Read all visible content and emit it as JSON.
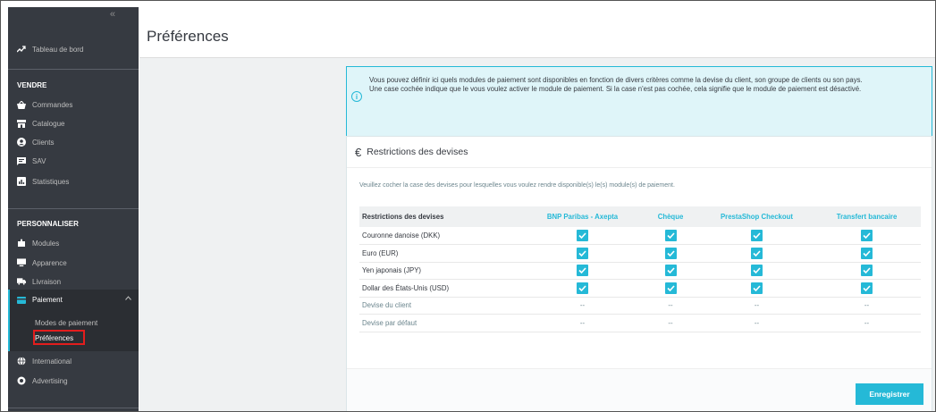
{
  "sidebar": {
    "collapse_glyph": "«",
    "dashboard": "Tableau de bord",
    "sections": {
      "sell": "VENDRE",
      "customize": "PERSONNALISER"
    },
    "sell_items": [
      "Commandes",
      "Catalogue",
      "Clients",
      "SAV",
      "Statistiques"
    ],
    "customize_items": [
      "Modules",
      "Apparence",
      "Livraison",
      "Paiement"
    ],
    "payment_sub": [
      "Modes de paiement",
      "Préférences"
    ],
    "bottom_items": [
      "International",
      "Advertising"
    ]
  },
  "page": {
    "title": "Préférences"
  },
  "alert": {
    "line1": "Vous pouvez définir ici quels modules de paiement sont disponibles en fonction de divers critères comme la devise du client, son groupe de clients ou son pays.",
    "line2": "Une case cochée indique que le vous voulez activer le module de paiement. Si la case n'est pas cochée, cela signifie que le module de paiement est désactivé."
  },
  "panel": {
    "title": "Restrictions des devises",
    "description": "Veuillez cocher la case des devises pour lesquelles vous voulez rendre disponible(s) le(s) module(s) de paiement.",
    "columns": [
      "Restrictions des devises",
      "BNP Paribas - Axepta",
      "Chèque",
      "PrestaShop Checkout",
      "Transfert bancaire"
    ],
    "rows": [
      {
        "label": "Couronne danoise (DKK)",
        "checked": [
          true,
          true,
          true,
          true
        ]
      },
      {
        "label": "Euro (EUR)",
        "checked": [
          true,
          true,
          true,
          true
        ]
      },
      {
        "label": "Yen japonais (JPY)",
        "checked": [
          true,
          true,
          true,
          true
        ]
      },
      {
        "label": "Dollar des États-Unis (USD)",
        "checked": [
          true,
          true,
          true,
          true
        ]
      }
    ],
    "static_rows": [
      {
        "label": "Devise du client",
        "values": [
          "--",
          "--",
          "--",
          "--"
        ]
      },
      {
        "label": "Devise par défaut",
        "values": [
          "--",
          "--",
          "--",
          "--"
        ]
      }
    ],
    "save_label": "Enregistrer"
  },
  "colors": {
    "accent": "#25b9d7",
    "sidebar_bg": "#363a41",
    "highlight_box": "#e31d1d"
  }
}
